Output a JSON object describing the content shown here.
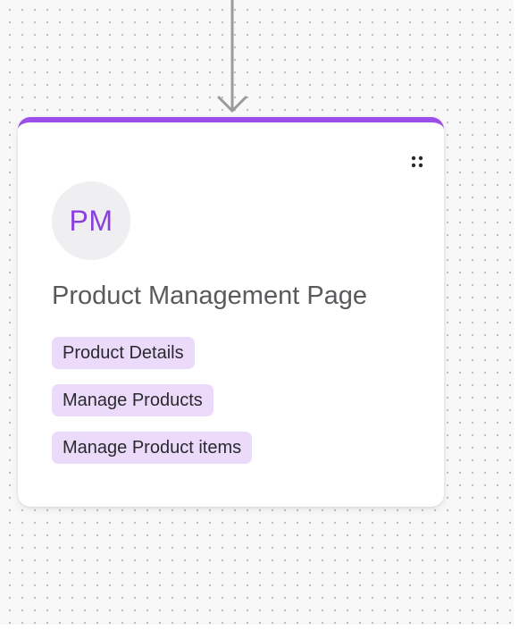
{
  "node": {
    "avatar_initials": "PM",
    "title": "Product Management Page",
    "tags": [
      {
        "label": "Product Details"
      },
      {
        "label": "Manage Products"
      },
      {
        "label": "Manage Product items"
      }
    ]
  },
  "icons": {
    "drag_handle": "drag-handle-icon",
    "connector": "arrow-down-icon"
  },
  "colors": {
    "accent": "#9d4eea",
    "avatar_text": "#8a3fe0",
    "avatar_bg": "#efeff1",
    "tag_bg": "#ecdafb",
    "title_text": "#5a5a5e",
    "connector": "#9b9b9b",
    "canvas_dot": "#b9b9bf"
  }
}
